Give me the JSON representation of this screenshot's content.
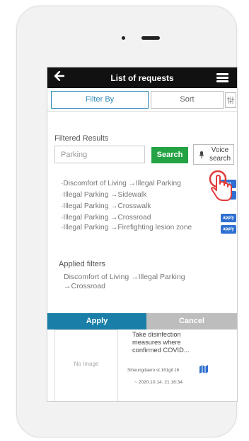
{
  "header": {
    "title": "List of requests",
    "back_icon": "arrow-left-icon",
    "menu_icon": "hamburger-menu-icon"
  },
  "tabs": {
    "filter_label": "Filter By",
    "sort_label": "Sort",
    "filter_settings_icon": "sliders-icon"
  },
  "filtered_results": {
    "title": "Filtered Results",
    "search_value": "Parking",
    "search_button": "Search",
    "voice_button": "Voice search",
    "items": [
      {
        "text": "·Discomfort of Living →Illegal Parking",
        "apply": "ap"
      },
      {
        "text": "·Illegal Parking →Sidewalk",
        "apply": "ap"
      },
      {
        "text": "·Illegal Parking →Crosswalk",
        "apply": ""
      },
      {
        "text": "·Illegal Parking →Crossroad",
        "apply": "apply"
      },
      {
        "text": "·Illegal Parking →Firefighting lesion zone",
        "apply": "apply"
      }
    ]
  },
  "applied_filters": {
    "title": "Applied filters",
    "value": "Discomfort of Living →Illegal Parking →Crossroad"
  },
  "actions": {
    "apply": "Apply",
    "cancel": "Cancel"
  },
  "card": {
    "image_placeholder": "No Image",
    "title": "Take disinfection measures where confirmed COVID...",
    "address": "Siheungdaero st.161gil 16",
    "date": "~ 2020.10.14. 21:16:34",
    "map_icon": "map-icon"
  },
  "colors": {
    "accent_blue": "#1a7fa8",
    "search_green": "#24a344",
    "cancel_gray": "#bdbdbd",
    "chip_blue": "#2f6fd1",
    "pointer_red": "#e23b3b"
  }
}
